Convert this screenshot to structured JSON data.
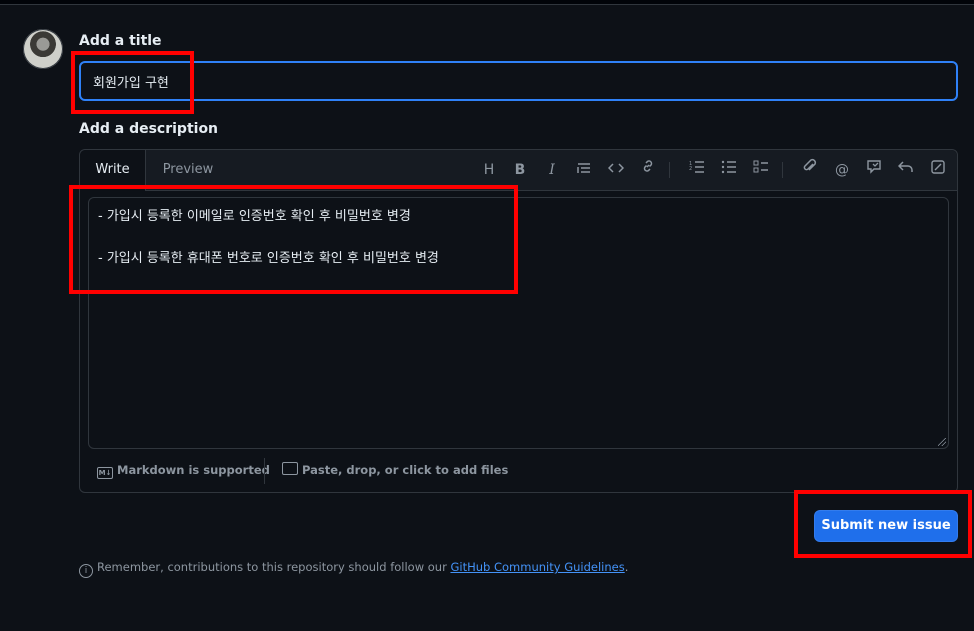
{
  "title_section": {
    "label": "Add a title",
    "value": "회원가입 구현"
  },
  "description_section": {
    "label": "Add a description",
    "tabs": {
      "write": "Write",
      "preview": "Preview"
    },
    "toolbar_icons": [
      "heading-icon",
      "bold-icon",
      "italic-icon",
      "quote-icon",
      "code-icon",
      "link-icon",
      "ordered-list-icon",
      "unordered-list-icon",
      "task-list-icon",
      "attach-icon",
      "mention-icon",
      "reference-icon",
      "undo-icon",
      "fullscreen-icon"
    ],
    "body_lines": [
      "- 가입시 등록한 이메일로 인증번호 확인 후 비밀번호 변경",
      "- 가입시 등록한 휴대폰 번호로 인증번호 확인 후 비밀번호 변경"
    ],
    "footer": {
      "markdown": "Markdown is supported",
      "attach": "Paste, drop, or click to add files"
    }
  },
  "submit_label": "Submit new issue",
  "note": {
    "prefix": "Remember, contributions to this repository should follow our ",
    "link": "GitHub Community Guidelines",
    "suffix": "."
  },
  "colors": {
    "background": "#0d1117",
    "accent": "#1f6feb",
    "focus": "#2f81f7",
    "annotation": "#ff0000"
  }
}
